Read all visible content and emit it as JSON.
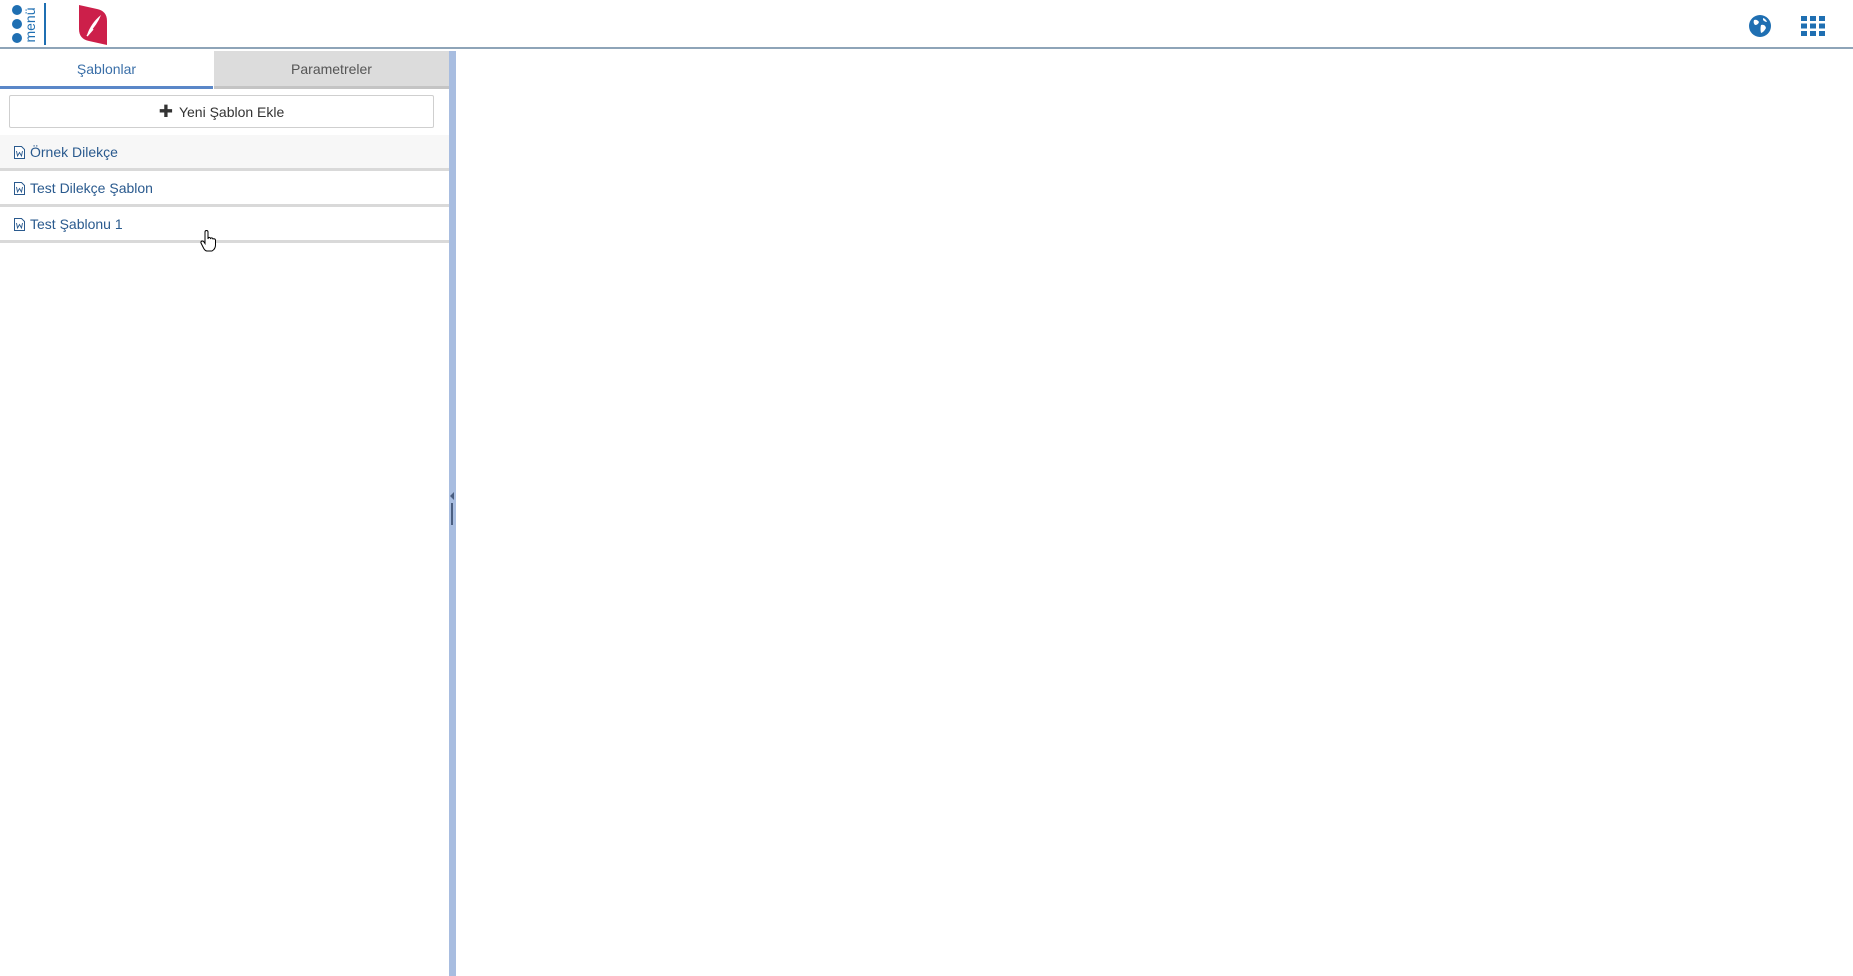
{
  "header": {
    "menu_label": "menü",
    "logo_icon": "quill-logo-icon",
    "right_icons": [
      "globe-icon",
      "apps-grid-icon"
    ],
    "brand_color": "#1f6fb2",
    "logo_color": "#cc1f4a"
  },
  "left_panel": {
    "tabs": [
      {
        "label": "Şablonlar",
        "active": true
      },
      {
        "label": "Parametreler",
        "active": false
      }
    ],
    "add_button": {
      "icon": "plus-icon",
      "label": "Yeni Şablon Ekle"
    },
    "templates": [
      {
        "label": "Örnek Dilekçe",
        "icon": "word-document-icon"
      },
      {
        "label": "Test Dilekçe Şablon",
        "icon": "word-document-icon"
      },
      {
        "label": "Test Şablonu 1",
        "icon": "word-document-icon"
      }
    ]
  }
}
